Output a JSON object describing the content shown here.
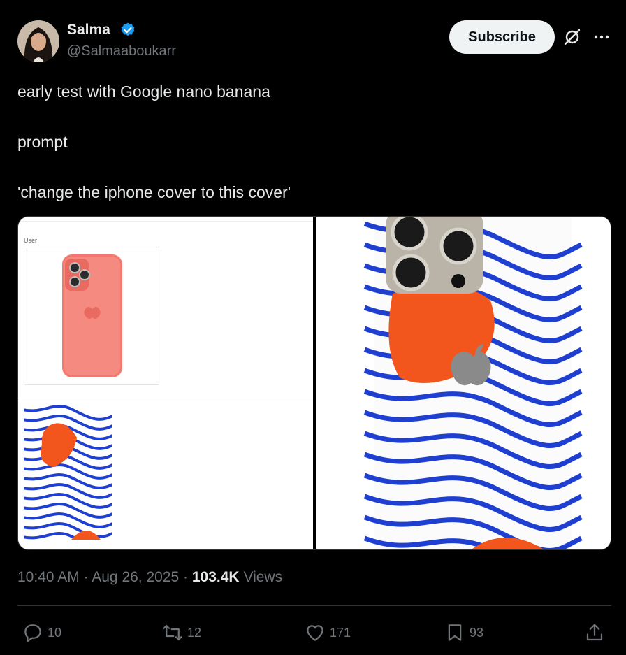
{
  "author": {
    "name": "Salma",
    "handle": "@Salmaaboukarr",
    "verified_color": "#1d9bf0"
  },
  "header": {
    "subscribe_label": "Subscribe",
    "grok_icon": "grok-icon",
    "more_icon": "more-icon"
  },
  "post": {
    "text": "early test with Google nano banana\n\nprompt\n\n'change the iphone cover to this cover'"
  },
  "media": {
    "user_label": "User",
    "accent_blue": "#1f3fd1",
    "accent_orange": "#f2561d",
    "phone_color": "#f4786e"
  },
  "meta": {
    "time": "10:40 AM",
    "date": "Aug 26, 2025",
    "views_count": "103.4K",
    "views_label": "Views"
  },
  "actions": {
    "replies": "10",
    "reposts": "12",
    "likes": "171",
    "bookmarks": "93"
  }
}
